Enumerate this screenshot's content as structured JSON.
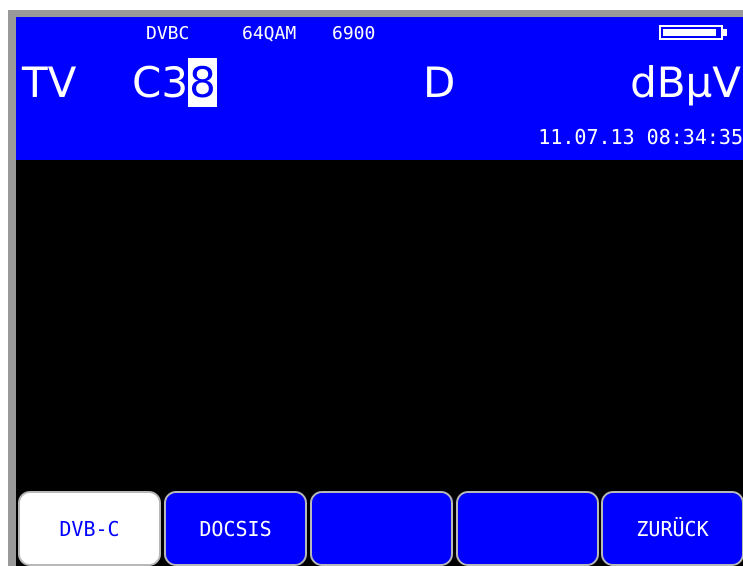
{
  "header": {
    "standard": "DVBC",
    "modulation": "64QAM",
    "symbol_rate": "6900",
    "mode": "TV",
    "channel_prefix": "C3",
    "channel_cursor_digit": "8",
    "type": "D",
    "unit": "dBµV",
    "datetime": "11.07.13 08:34:35",
    "battery_level": 0.95
  },
  "softkeys": [
    {
      "label": "DVB-C",
      "active": true
    },
    {
      "label": "DOCSIS",
      "active": false
    },
    {
      "label": "",
      "active": false
    },
    {
      "label": "",
      "active": false
    },
    {
      "label": "ZURÜCK",
      "active": false
    }
  ],
  "colors": {
    "header_bg": "#0000ff",
    "screen_bg": "#000000",
    "text": "#ffffff"
  }
}
